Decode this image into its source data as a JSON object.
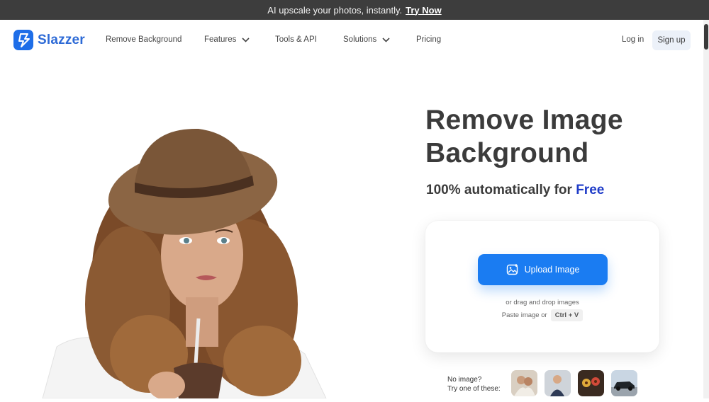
{
  "promo": {
    "text": "AI upscale your photos, instantly.",
    "link": "Try Now"
  },
  "nav": {
    "logo_text": "Slazzer",
    "items": [
      "Remove Background",
      "Features",
      "Tools & API",
      "Solutions",
      "Pricing"
    ],
    "login": "Log in",
    "signup": "Sign up"
  },
  "hero": {
    "title_line1": "Remove Image",
    "title_line2": "Background",
    "subtitle_prefix": "100% automatically for",
    "subtitle_free": "Free"
  },
  "upload": {
    "button": "Upload Image",
    "drag_text": "or drag and drop images",
    "paste_text": "Paste image or",
    "shortcut": "Ctrl + V"
  },
  "samples": {
    "line1": "No image?",
    "line2": "Try one of these:"
  },
  "colors": {
    "accent": "#1a7cf2",
    "free": "#1f3cc8",
    "topbar": "#3d3d3d"
  }
}
